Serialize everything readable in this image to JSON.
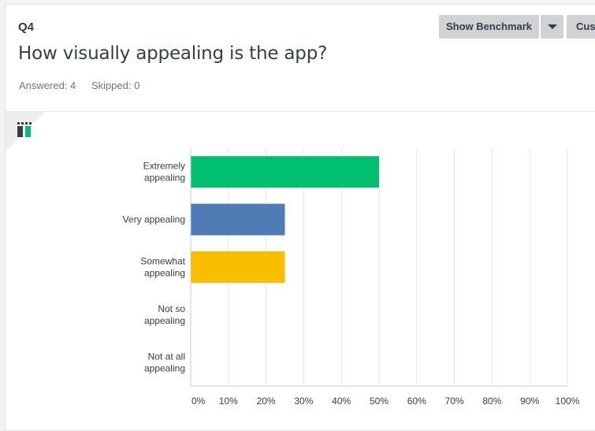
{
  "question": {
    "number": "Q4",
    "title": "How visually appealing is the app?",
    "answered": "Answered: 4",
    "skipped": "Skipped: 0"
  },
  "toolbar": {
    "benchmark_label": "Show Benchmark",
    "customize_label": "Customize"
  },
  "icons": {
    "chart_type": "bar-chart-icon",
    "dropdown": "chevron-down-icon"
  },
  "chart_data": {
    "type": "bar",
    "orientation": "horizontal",
    "categories": [
      [
        "Extremely",
        "appealing"
      ],
      [
        "Very appealing"
      ],
      [
        "Somewhat",
        "appealing"
      ],
      [
        "Not so",
        "appealing"
      ],
      [
        "Not at all",
        "appealing"
      ]
    ],
    "values": [
      50,
      25,
      25,
      0,
      0
    ],
    "colors": [
      "#00bf6f",
      "#507cb6",
      "#f9be00",
      "#6bc8cd",
      "#757e86"
    ],
    "xticks": [
      "0%",
      "10%",
      "20%",
      "30%",
      "40%",
      "50%",
      "60%",
      "70%",
      "80%",
      "90%",
      "100%"
    ],
    "xlim": [
      0,
      100
    ],
    "grid": true
  }
}
